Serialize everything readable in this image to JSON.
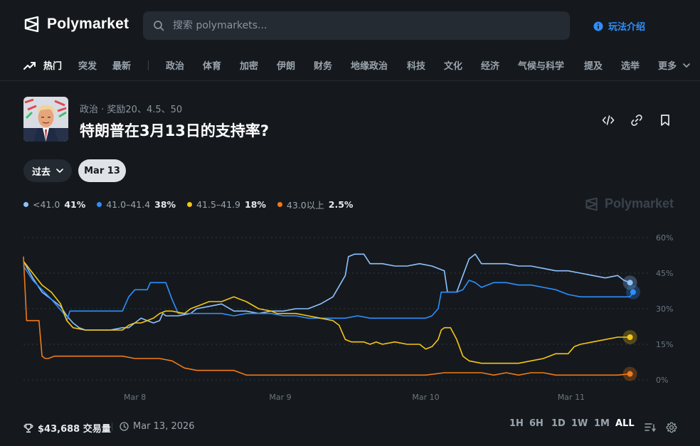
{
  "app": {
    "name": "Polymarket",
    "search_placeholder": "搜索 polymarkets...",
    "how_it_works": "玩法介绍"
  },
  "nav": {
    "items": [
      "热门",
      "突发",
      "最新",
      "政治",
      "体育",
      "加密",
      "伊朗",
      "财务",
      "地缘政治",
      "科技",
      "文化",
      "经济",
      "气候与科学",
      "提及",
      "选举",
      "更多"
    ]
  },
  "market": {
    "category": "政治 · 奖励20、4.5、50",
    "title": "特朗普在3月13日的支持率?",
    "past_label": "过去",
    "date_label": "Mar 13",
    "volume": "$43,688 交易量",
    "end_date": "Mar 13, 2026"
  },
  "legend": [
    {
      "label": "<41.0",
      "value": "41%",
      "color": "#8fc2ff"
    },
    {
      "label": "41.0–41.4",
      "value": "38%",
      "color": "#2e8fff"
    },
    {
      "label": "41.5–41.9",
      "value": "18%",
      "color": "#f5c518"
    },
    {
      "label": "43.0以上",
      "value": "2.5%",
      "color": "#f07a1a"
    }
  ],
  "time_ranges": [
    "1H",
    "6H",
    "1D",
    "1W",
    "1M",
    "ALL"
  ],
  "time_range_selected": "ALL",
  "colors": {
    "background": "#15191d",
    "accent": "#2e8fff"
  },
  "chart_data": {
    "type": "line",
    "x_ticks": [
      "Mar 8",
      "Mar 9",
      "Mar 10",
      "Mar 11"
    ],
    "y_ticks": [
      "60%",
      "45%",
      "30%",
      "15%",
      "0%"
    ],
    "ylim": [
      0,
      60
    ],
    "x_domain": [
      0,
      100
    ],
    "grid": true,
    "watermark": "Polymarket",
    "series": [
      {
        "name": "<41.0",
        "color": "#8fc2ff",
        "points": [
          [
            0,
            50
          ],
          [
            1.5,
            43
          ],
          [
            3,
            37
          ],
          [
            4.5,
            34
          ],
          [
            6,
            31
          ],
          [
            7,
            27
          ],
          [
            8,
            24
          ],
          [
            9,
            22
          ],
          [
            10,
            21
          ],
          [
            12,
            21
          ],
          [
            14,
            21
          ],
          [
            16,
            22
          ],
          [
            17,
            22
          ],
          [
            18,
            24
          ],
          [
            19,
            26
          ],
          [
            20,
            25
          ],
          [
            21,
            24
          ],
          [
            22,
            25
          ],
          [
            22.5,
            28
          ],
          [
            23,
            27
          ],
          [
            25,
            27
          ],
          [
            27,
            28
          ],
          [
            28,
            30
          ],
          [
            30,
            31
          ],
          [
            32,
            32
          ],
          [
            34,
            29
          ],
          [
            36,
            29
          ],
          [
            38,
            28
          ],
          [
            40,
            29
          ],
          [
            42,
            29
          ],
          [
            44,
            30
          ],
          [
            46,
            30
          ],
          [
            48,
            32
          ],
          [
            50,
            35
          ],
          [
            52,
            44
          ],
          [
            52.5,
            52
          ],
          [
            53.5,
            53
          ],
          [
            55,
            53
          ],
          [
            56,
            49
          ],
          [
            58,
            49
          ],
          [
            60,
            48
          ],
          [
            62,
            48
          ],
          [
            64,
            49
          ],
          [
            66,
            48
          ],
          [
            68,
            46
          ],
          [
            68.5,
            37
          ],
          [
            70,
            37
          ],
          [
            71,
            44
          ],
          [
            72,
            51
          ],
          [
            73,
            53
          ],
          [
            74,
            49
          ],
          [
            76,
            49
          ],
          [
            78,
            49
          ],
          [
            80,
            48
          ],
          [
            82,
            48
          ],
          [
            84,
            47
          ],
          [
            86,
            46
          ],
          [
            88,
            46
          ],
          [
            90,
            45
          ],
          [
            92,
            44
          ],
          [
            94,
            43
          ],
          [
            96,
            44
          ],
          [
            97,
            42
          ],
          [
            98,
            41
          ]
        ]
      },
      {
        "name": "41.0–41.4",
        "color": "#2e8fff",
        "points": [
          [
            0,
            48
          ],
          [
            1.5,
            42
          ],
          [
            3,
            38
          ],
          [
            4.5,
            34
          ],
          [
            5.5,
            31
          ],
          [
            6.5,
            28
          ],
          [
            7,
            25
          ],
          [
            7.5,
            29
          ],
          [
            8.5,
            29
          ],
          [
            10,
            29
          ],
          [
            12,
            29
          ],
          [
            14,
            29
          ],
          [
            16,
            29
          ],
          [
            17,
            35
          ],
          [
            18,
            38
          ],
          [
            18.5,
            38
          ],
          [
            20,
            38
          ],
          [
            20.5,
            41
          ],
          [
            21,
            41
          ],
          [
            23,
            41
          ],
          [
            24,
            34
          ],
          [
            25,
            28
          ],
          [
            27,
            28
          ],
          [
            30,
            28
          ],
          [
            32,
            28
          ],
          [
            34,
            27
          ],
          [
            36,
            28
          ],
          [
            38,
            28
          ],
          [
            40,
            28
          ],
          [
            42,
            27
          ],
          [
            44,
            27
          ],
          [
            46,
            26
          ],
          [
            48,
            26
          ],
          [
            50,
            26
          ],
          [
            52,
            26
          ],
          [
            54,
            27
          ],
          [
            56,
            26
          ],
          [
            58,
            26
          ],
          [
            60,
            26
          ],
          [
            62,
            26
          ],
          [
            64,
            26
          ],
          [
            65,
            26
          ],
          [
            66,
            27
          ],
          [
            67,
            30
          ],
          [
            67.5,
            37
          ],
          [
            68,
            37
          ],
          [
            70,
            37
          ],
          [
            71,
            38
          ],
          [
            72,
            42
          ],
          [
            73,
            41
          ],
          [
            74,
            39
          ],
          [
            76,
            41
          ],
          [
            78,
            41
          ],
          [
            80,
            40
          ],
          [
            82,
            40
          ],
          [
            84,
            39
          ],
          [
            86,
            38
          ],
          [
            88,
            36
          ],
          [
            90,
            35
          ],
          [
            92,
            35
          ],
          [
            94,
            35
          ],
          [
            96,
            35
          ],
          [
            98,
            35
          ],
          [
            98.5,
            37
          ]
        ]
      },
      {
        "name": "41.5–41.9",
        "color": "#f5c518",
        "points": [
          [
            0,
            50
          ],
          [
            1.5,
            45
          ],
          [
            3,
            40
          ],
          [
            4.5,
            37
          ],
          [
            6,
            32
          ],
          [
            7,
            25
          ],
          [
            8,
            22
          ],
          [
            10,
            21
          ],
          [
            12,
            21
          ],
          [
            14,
            21
          ],
          [
            16,
            21
          ],
          [
            17,
            23
          ],
          [
            18,
            24
          ],
          [
            19,
            24
          ],
          [
            20,
            25
          ],
          [
            21,
            26
          ],
          [
            22,
            28
          ],
          [
            23,
            29
          ],
          [
            24,
            29
          ],
          [
            26,
            28
          ],
          [
            27,
            30
          ],
          [
            28,
            31
          ],
          [
            30,
            33
          ],
          [
            32,
            33
          ],
          [
            34,
            35
          ],
          [
            35,
            34
          ],
          [
            36,
            33
          ],
          [
            38,
            30
          ],
          [
            40,
            29
          ],
          [
            41,
            28
          ],
          [
            42,
            28
          ],
          [
            44,
            28
          ],
          [
            46,
            27
          ],
          [
            48,
            26
          ],
          [
            50,
            25
          ],
          [
            51,
            23
          ],
          [
            52,
            17
          ],
          [
            53,
            16
          ],
          [
            55,
            16
          ],
          [
            56,
            15
          ],
          [
            57,
            16
          ],
          [
            58,
            15
          ],
          [
            60,
            16
          ],
          [
            62,
            15
          ],
          [
            64,
            15
          ],
          [
            65,
            13
          ],
          [
            66,
            14
          ],
          [
            67,
            17
          ],
          [
            67.5,
            21
          ],
          [
            68,
            22
          ],
          [
            69,
            22
          ],
          [
            70,
            17
          ],
          [
            71,
            10
          ],
          [
            72,
            8
          ],
          [
            74,
            7
          ],
          [
            76,
            7
          ],
          [
            78,
            7
          ],
          [
            80,
            7
          ],
          [
            82,
            8
          ],
          [
            84,
            9
          ],
          [
            86,
            11
          ],
          [
            88,
            11
          ],
          [
            89,
            14
          ],
          [
            90,
            15
          ],
          [
            92,
            16
          ],
          [
            94,
            17
          ],
          [
            96,
            18
          ],
          [
            98,
            18
          ]
        ]
      },
      {
        "name": "43.0以上",
        "color": "#f07a1a",
        "points": [
          [
            0,
            52
          ],
          [
            0.5,
            25
          ],
          [
            2,
            25
          ],
          [
            2.5,
            25
          ],
          [
            3,
            10
          ],
          [
            3.5,
            9
          ],
          [
            4,
            9
          ],
          [
            5,
            10
          ],
          [
            7,
            10
          ],
          [
            10,
            10
          ],
          [
            12,
            10
          ],
          [
            14,
            10
          ],
          [
            16,
            10
          ],
          [
            18,
            9
          ],
          [
            20,
            9
          ],
          [
            22,
            9
          ],
          [
            24,
            8
          ],
          [
            26,
            5
          ],
          [
            28,
            4
          ],
          [
            30,
            4
          ],
          [
            32,
            4
          ],
          [
            34,
            4
          ],
          [
            36,
            2
          ],
          [
            38,
            2
          ],
          [
            40,
            2
          ],
          [
            42,
            2
          ],
          [
            44,
            2
          ],
          [
            46,
            2
          ],
          [
            48,
            2
          ],
          [
            50,
            2
          ],
          [
            55,
            2
          ],
          [
            60,
            2
          ],
          [
            65,
            2
          ],
          [
            68,
            3
          ],
          [
            70,
            3
          ],
          [
            72,
            3
          ],
          [
            74,
            3
          ],
          [
            76,
            2
          ],
          [
            78,
            3
          ],
          [
            80,
            2
          ],
          [
            82,
            3
          ],
          [
            84,
            3
          ],
          [
            86,
            2
          ],
          [
            88,
            2
          ],
          [
            90,
            2
          ],
          [
            92,
            2
          ],
          [
            94,
            2
          ],
          [
            96,
            2
          ],
          [
            98,
            2.5
          ]
        ]
      }
    ]
  }
}
